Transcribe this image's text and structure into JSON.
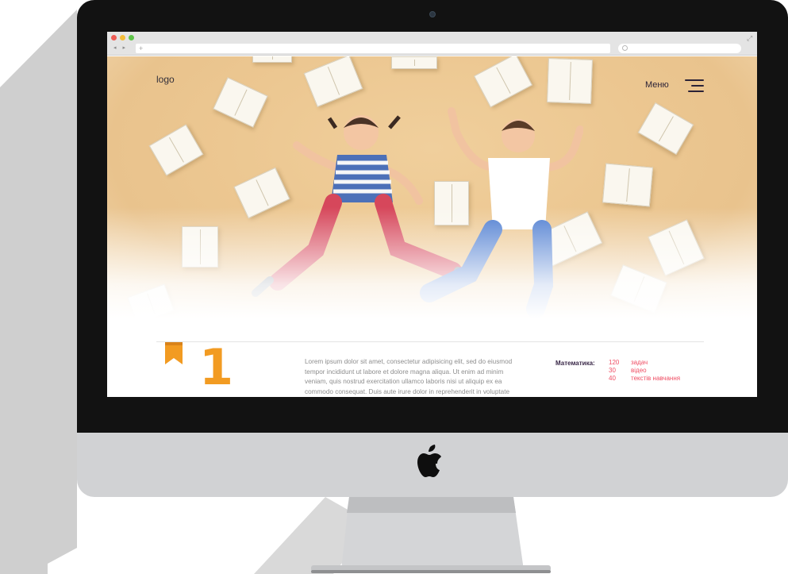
{
  "browser": {
    "nav_arrows": "◂ ▸",
    "new_tab": "+",
    "expand_icon": "⤢"
  },
  "site": {
    "logo": "logo",
    "menu_label": "Меню"
  },
  "content": {
    "section_number": "1",
    "lorem": "Lorem ipsum dolor sit amet, consectetur adipisicing elit, sed do eiusmod tempor incididunt ut labore et dolore magna aliqua. Ut enim ad minim veniam, quis nostrud exercitation ullamco laboris nisi ut aliquip ex ea commodo consequat. Duis aute irure dolor in reprehenderit in voluptate",
    "stats_label": "Математика:",
    "stats": [
      {
        "value": "120",
        "label": "задач"
      },
      {
        "value": "30",
        "label": "відео"
      },
      {
        "value": "40",
        "label": "текстів навчання"
      }
    ]
  },
  "colors": {
    "accent_orange": "#f29b22",
    "stats_pink": "#ef4e64",
    "menu_dark": "#2b2237",
    "hero_background": "#ecc791"
  },
  "icons": [
    "apple-logo-icon",
    "hamburger-menu-icon",
    "bookmark-ribbon-icon",
    "search-icon",
    "expand-icon"
  ]
}
